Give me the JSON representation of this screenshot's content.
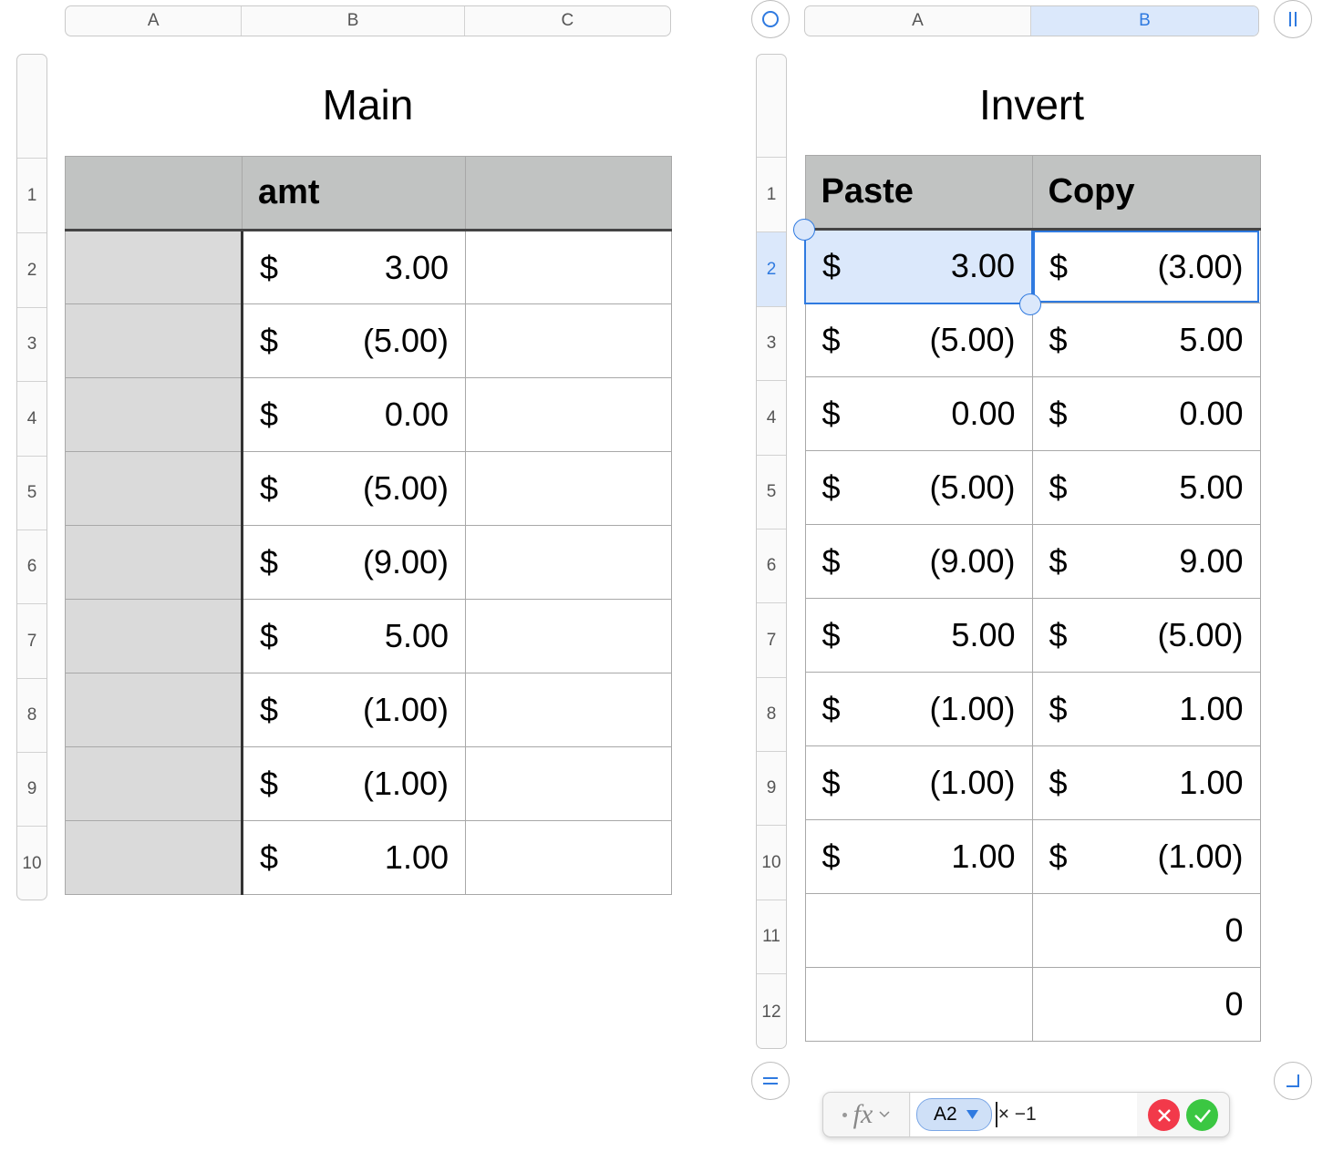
{
  "left_sheet": {
    "columns": [
      "A",
      "B",
      "C"
    ],
    "title": "Main",
    "header_row": [
      "",
      "amt",
      ""
    ],
    "row_numbers": [
      "1",
      "2",
      "3",
      "4",
      "5",
      "6",
      "7",
      "8",
      "9",
      "10"
    ],
    "rows": [
      {
        "sym": "$",
        "val": "3.00"
      },
      {
        "sym": "$",
        "val": "(5.00)"
      },
      {
        "sym": "$",
        "val": "0.00"
      },
      {
        "sym": "$",
        "val": "(5.00)"
      },
      {
        "sym": "$",
        "val": "(9.00)"
      },
      {
        "sym": "$",
        "val": "5.00"
      },
      {
        "sym": "$",
        "val": "(1.00)"
      },
      {
        "sym": "$",
        "val": "(1.00)"
      },
      {
        "sym": "$",
        "val": "1.00"
      }
    ]
  },
  "right_sheet": {
    "columns": [
      "A",
      "B"
    ],
    "selected_column": "B",
    "title": "Invert",
    "header_row": [
      "Paste",
      "Copy"
    ],
    "row_numbers": [
      "1",
      "2",
      "3",
      "4",
      "5",
      "6",
      "7",
      "8",
      "9",
      "10",
      "11",
      "12"
    ],
    "selected_row": "2",
    "rows": [
      {
        "a_sym": "$",
        "a_val": "3.00",
        "b_sym": "$",
        "b_val": "(3.00)"
      },
      {
        "a_sym": "$",
        "a_val": "(5.00)",
        "b_sym": "$",
        "b_val": "5.00"
      },
      {
        "a_sym": "$",
        "a_val": "0.00",
        "b_sym": "$",
        "b_val": "0.00"
      },
      {
        "a_sym": "$",
        "a_val": "(5.00)",
        "b_sym": "$",
        "b_val": "5.00"
      },
      {
        "a_sym": "$",
        "a_val": "(9.00)",
        "b_sym": "$",
        "b_val": "9.00"
      },
      {
        "a_sym": "$",
        "a_val": "5.00",
        "b_sym": "$",
        "b_val": "(5.00)"
      },
      {
        "a_sym": "$",
        "a_val": "(1.00)",
        "b_sym": "$",
        "b_val": "1.00"
      },
      {
        "a_sym": "$",
        "a_val": "(1.00)",
        "b_sym": "$",
        "b_val": "1.00"
      },
      {
        "a_sym": "$",
        "a_val": "1.00",
        "b_sym": "$",
        "b_val": "(1.00)"
      },
      {
        "a_sym": "",
        "a_val": "",
        "b_sym": "",
        "b_val": "0"
      },
      {
        "a_sym": "",
        "a_val": "",
        "b_sym": "",
        "b_val": "0"
      }
    ]
  },
  "formula_bar": {
    "fx_label": "fx",
    "cell_ref": "A2",
    "formula_rest": "× −1"
  },
  "colors": {
    "selection_blue": "#2f7ae0",
    "selection_fill": "#dbe8fb",
    "header_gray": "#c1c3c2",
    "cancel_red": "#f2394a",
    "confirm_green": "#3bc742"
  },
  "icons": [
    "select-table-circle-icon",
    "freeze-columns-icon",
    "freeze-rows-icon",
    "resize-table-corner-icon",
    "chevron-down-icon",
    "triangle-down-icon",
    "cancel-x-icon",
    "confirm-check-icon"
  ]
}
